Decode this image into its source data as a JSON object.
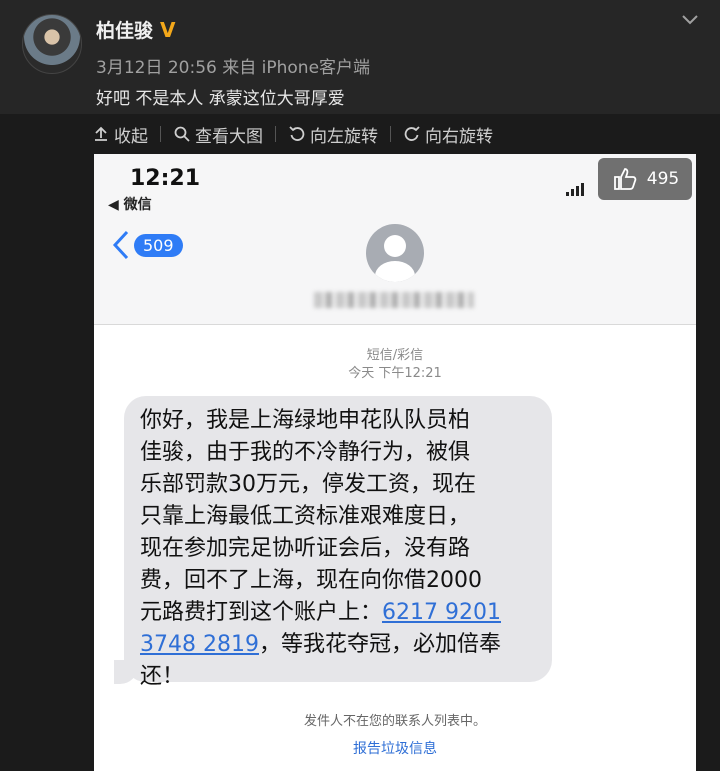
{
  "post": {
    "username": "柏佳骏",
    "verified_badge": "V",
    "date": "3月12日 20:56",
    "source": "来自 iPhone客户端",
    "text": "好吧 不是本人 承蒙这位大哥厚爱"
  },
  "toolbar": {
    "collapse_label": "收起",
    "view_large_label": "查看大图",
    "rotate_left_label": "向左旋转",
    "rotate_right_label": "向右旋转"
  },
  "likes": {
    "count": "495"
  },
  "phone": {
    "time": "12:21",
    "back_app": "◀ 微信",
    "back_badge": "509",
    "message_type": "短信/彩信",
    "message_time": "今天 下午12:21",
    "message_before": "你好，我是上海绿地申花队队员柏\n佳骏，由于我的不冷静行为，被俱\n乐部罚款30万元，停发工资，现在\n只靠上海最低工资标准艰难度日，\n现在参加完足协听证会后，没有路\n费，回不了上海，现在向你借2000\n元路费打到这个账户上：",
    "account_number": "6217 9201\n3748 2819",
    "message_after": "，等我花夺冠，必加倍奉\n还！",
    "not_contact_notice": "发件人不在您的联系人列表中。",
    "report_link": "报告垃圾信息"
  },
  "colors": {
    "link": "#2f6fd6",
    "badge": "#2f7cf6",
    "verified": "#f3a81a"
  }
}
